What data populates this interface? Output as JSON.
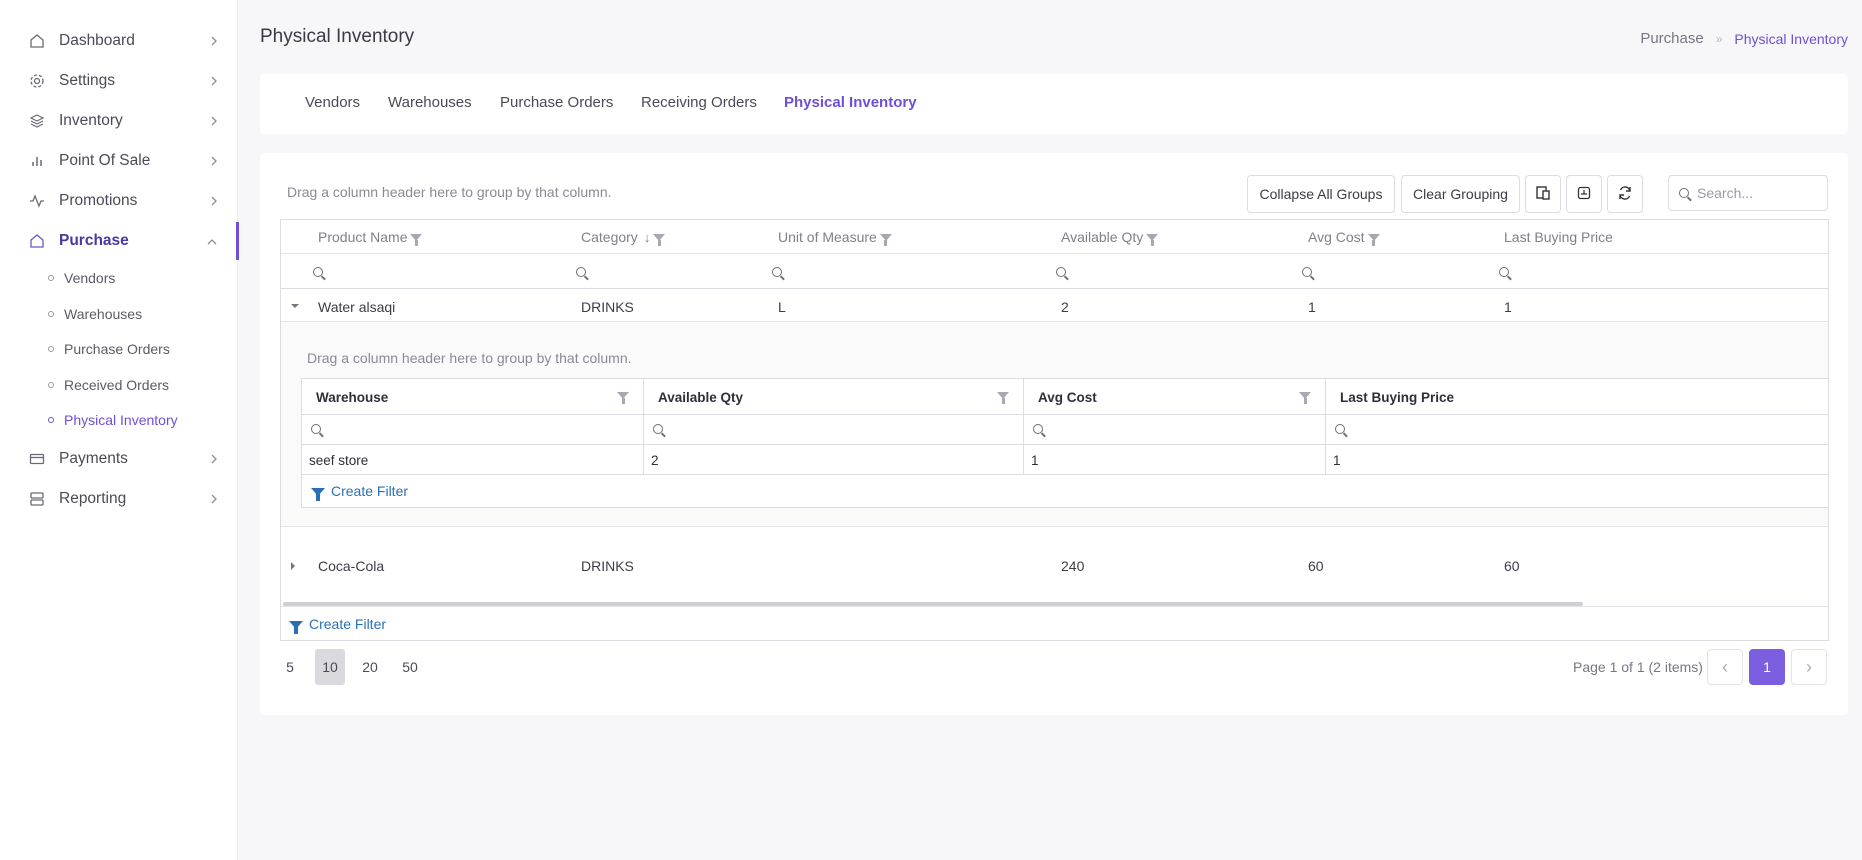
{
  "sidebar": {
    "items": [
      {
        "label": "Dashboard",
        "icon": "home-icon"
      },
      {
        "label": "Settings",
        "icon": "gear-icon"
      },
      {
        "label": "Inventory",
        "icon": "layers-icon"
      },
      {
        "label": "Point Of Sale",
        "icon": "bar-chart-icon"
      },
      {
        "label": "Promotions",
        "icon": "activity-icon"
      },
      {
        "label": "Purchase",
        "icon": "home-icon"
      },
      {
        "label": "Payments",
        "icon": "credit-card-icon"
      },
      {
        "label": "Reporting",
        "icon": "server-icon"
      }
    ],
    "purchase_sub": [
      "Vendors",
      "Warehouses",
      "Purchase Orders",
      "Received Orders",
      "Physical Inventory"
    ]
  },
  "header": {
    "title": "Physical Inventory",
    "breadcrumb": [
      "Purchase",
      "Physical Inventory"
    ]
  },
  "tabs": [
    "Vendors",
    "Warehouses",
    "Purchase Orders",
    "Receiving Orders",
    "Physical Inventory"
  ],
  "toolbar": {
    "group_hint": "Drag a column header here to group by that column.",
    "collapse_all": "Collapse All Groups",
    "clear_grouping": "Clear Grouping",
    "search_placeholder": "Search..."
  },
  "grid": {
    "columns": [
      "Product Name",
      "Category",
      "Unit of Measure",
      "Available Qty",
      "Avg Cost",
      "Last Buying Price"
    ],
    "rows": [
      {
        "product": "Water alsaqi",
        "category": "DRINKS",
        "uom": "L",
        "qty": "2",
        "avg": "1",
        "last": "1",
        "expanded": true
      },
      {
        "product": "Coca-Cola",
        "category": "DRINKS",
        "uom": "",
        "qty": "240",
        "avg": "60",
        "last": "60",
        "expanded": false
      }
    ],
    "detail": {
      "group_hint": "Drag a column header here to group by that column.",
      "columns": [
        "Warehouse",
        "Available Qty",
        "Avg Cost",
        "Last Buying Price"
      ],
      "rows": [
        {
          "warehouse": "seef store",
          "qty": "2",
          "avg": "1",
          "last": "1"
        }
      ],
      "create_filter": "Create Filter"
    },
    "create_filter": "Create Filter"
  },
  "pager": {
    "sizes": [
      "5",
      "10",
      "20",
      "50"
    ],
    "selected_size": "10",
    "info": "Page 1 of 1 (2 items)",
    "current_page": "1"
  },
  "colors": {
    "accent": "#6f4fd8",
    "link": "#2a6fb6"
  }
}
